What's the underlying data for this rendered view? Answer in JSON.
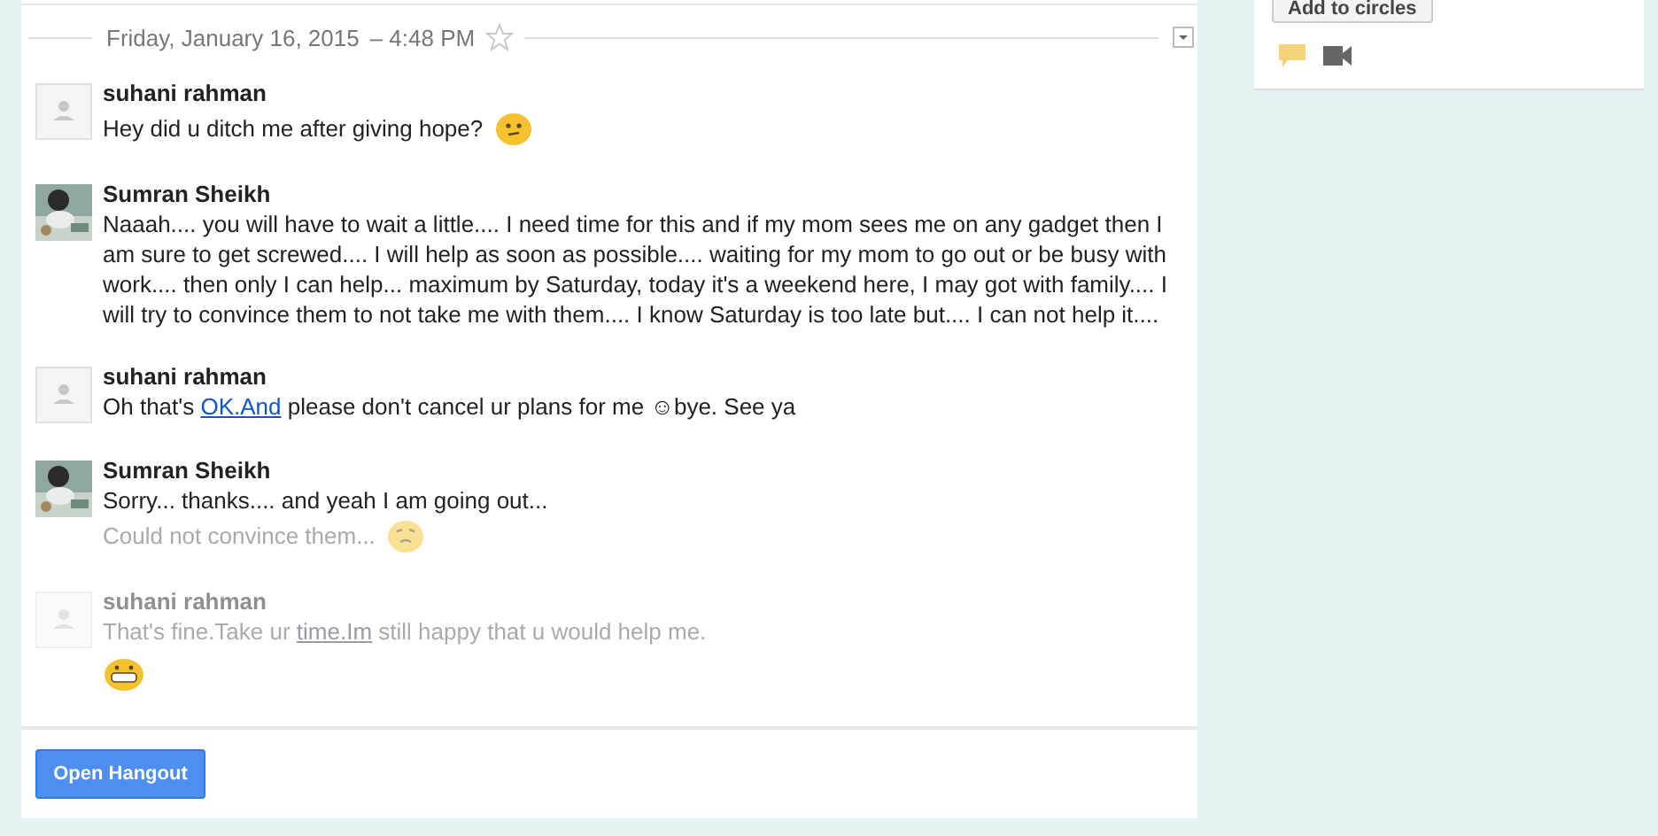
{
  "conversation": {
    "date": "Friday, January 16, 2015",
    "time": "– 4:48 PM",
    "starred": false,
    "messages": [
      {
        "author": "suhani rahman",
        "photo": false,
        "faded": false,
        "lines": [
          {
            "faded": false,
            "parts": [
              {
                "kind": "text",
                "text": "Hey did u ditch me after giving hope?"
              },
              {
                "kind": "confused"
              }
            ]
          }
        ]
      },
      {
        "author": "Sumran Sheikh",
        "photo": true,
        "faded": false,
        "lines": [
          {
            "faded": false,
            "parts": [
              {
                "kind": "text",
                "text": "Naaah.... you will have to wait a little.... I need time for this and if my mom sees me on any gadget then I am sure to get screwed.... I will help as soon as possible.... waiting for my mom to go out or be busy with work.... then only I can help... maximum by Saturday, today it's a weekend here, I may got with family.... I will try to convince them to not take me with them.... I know Saturday is too late but.... I can not help it...."
              }
            ]
          }
        ]
      },
      {
        "author": "suhani rahman",
        "photo": false,
        "faded": false,
        "lines": [
          {
            "faded": false,
            "parts": [
              {
                "kind": "text",
                "text": "Oh that's "
              },
              {
                "kind": "link",
                "text": "OK.And"
              },
              {
                "kind": "text",
                "text": " please don't cancel ur plans for me ☺bye. See ya"
              }
            ]
          }
        ]
      },
      {
        "author": "Sumran Sheikh",
        "photo": true,
        "faded": false,
        "lines": [
          {
            "faded": false,
            "parts": [
              {
                "kind": "text",
                "text": "Sorry... thanks.... and yeah I am going out..."
              }
            ]
          },
          {
            "faded": true,
            "parts": [
              {
                "kind": "text",
                "text": "Could not convince them..."
              },
              {
                "kind": "worried"
              }
            ]
          }
        ]
      },
      {
        "author": "suhani rahman",
        "photo": false,
        "faded": true,
        "lines": [
          {
            "faded": true,
            "parts": [
              {
                "kind": "text",
                "text": "That's fine.Take ur "
              },
              {
                "kind": "link",
                "text": "time.Im"
              },
              {
                "kind": "text",
                "text": " still happy that u would help me."
              }
            ]
          },
          {
            "faded": false,
            "parts": [
              {
                "kind": "grin"
              }
            ]
          }
        ]
      }
    ]
  },
  "open_hangout_button": "Open Hangout",
  "side_panel": {
    "add_to_circles_button": "Add to circles"
  }
}
